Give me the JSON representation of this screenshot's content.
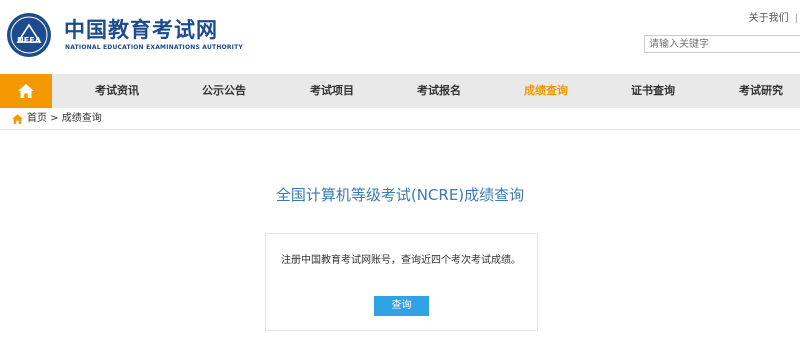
{
  "header": {
    "logo_text": "NEEA",
    "site_name": "中国教育考试网",
    "site_name_en": "NATIONAL EDUCATION EXAMINATIONS AUTHORITY",
    "top_link_about": "关于我们",
    "top_link_sep": "|",
    "search_placeholder": "请输入关键字"
  },
  "nav": {
    "items": [
      {
        "label": "考试资讯"
      },
      {
        "label": "公示公告"
      },
      {
        "label": "考试项目"
      },
      {
        "label": "考试报名"
      },
      {
        "label": "成绩查询"
      },
      {
        "label": "证书查询"
      },
      {
        "label": "考试研究"
      }
    ],
    "active_index": 4
  },
  "breadcrumb": "首页 > 成绩查询",
  "main": {
    "title": "全国计算机等级考试(NCRE)成绩查询",
    "card_text": "注册中国教育考试网账号，查询近四个考次考试成绩。",
    "button_label": "查询"
  },
  "colors": {
    "brand_blue": "#1c4b8e",
    "accent_orange": "#f39800",
    "title_blue": "#3b7ab6",
    "button_blue": "#2fa3e6"
  }
}
